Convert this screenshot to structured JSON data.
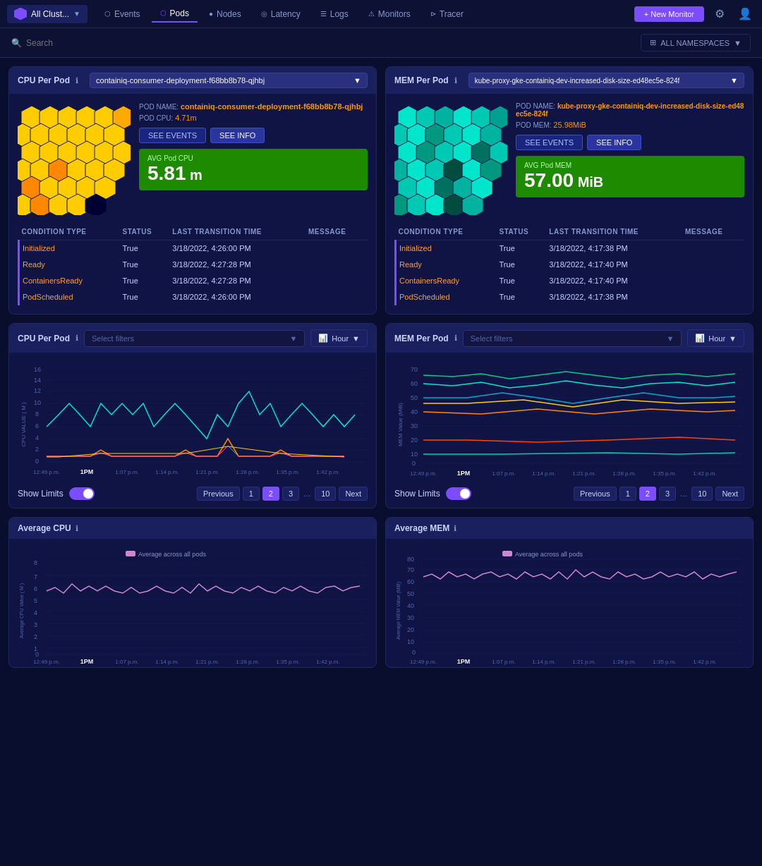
{
  "nav": {
    "brand": "All Clust...",
    "items": [
      {
        "label": "Events",
        "icon": "⬡",
        "active": false
      },
      {
        "label": "Pods",
        "icon": "⬡",
        "active": true
      },
      {
        "label": "Nodes",
        "icon": "⬡",
        "active": false
      },
      {
        "label": "Latency",
        "icon": "⬡",
        "active": false
      },
      {
        "label": "Logs",
        "icon": "⬡",
        "active": false
      },
      {
        "label": "Monitors",
        "icon": "⬡",
        "active": false
      },
      {
        "label": "Tracer",
        "icon": "⬡",
        "active": false
      }
    ],
    "new_monitor": "+ New Monitor",
    "all_namespaces": "ALL NAMESPACES"
  },
  "search": {
    "placeholder": "Search"
  },
  "cpu_pod_panel": {
    "title": "CPU Per Pod",
    "selected_pod": "containiq-consumer-deployment-f68bb8b78-qjhbj",
    "pod_name_label": "POD NAME:",
    "pod_name_val": "containiq-consumer-deployment-f68bb8b78-qjhbj",
    "pod_cpu_label": "POD CPU:",
    "pod_cpu_val": "4.71m",
    "btn_events": "SEE EVENTS",
    "btn_info": "SEE INFO",
    "avg_label": "AVG Pod CPU",
    "avg_value": "5.81",
    "avg_unit": " m"
  },
  "mem_pod_panel": {
    "title": "MEM Per Pod",
    "selected_pod": "kube-proxy-gke-containiq-dev-increased-disk-size-ed48ec5e-824f",
    "pod_name_label": "POD NAME:",
    "pod_name_val": "kube-proxy-gke-containiq-dev-increased-disk-size-ed48ec5e-824f",
    "pod_mem_label": "POD MEM:",
    "pod_mem_val": "25.98MiB",
    "btn_events": "SEE EVENTS",
    "btn_info": "SEE INFO",
    "avg_label": "AVG Pod MEM",
    "avg_value": "57.00",
    "avg_unit": " MiB"
  },
  "conditions_cpu": {
    "headers": [
      "CONDITION TYPE",
      "STATUS",
      "LAST TRANSITION TIME",
      "MESSAGE"
    ],
    "rows": [
      {
        "type": "Initialized",
        "status": "True",
        "time": "3/18/2022, 4:26:00 PM",
        "message": ""
      },
      {
        "type": "Ready",
        "status": "True",
        "time": "3/18/2022, 4:27:28 PM",
        "message": ""
      },
      {
        "type": "ContainersReady",
        "status": "True",
        "time": "3/18/2022, 4:27:28 PM",
        "message": ""
      },
      {
        "type": "PodScheduled",
        "status": "True",
        "time": "3/18/2022, 4:26:00 PM",
        "message": ""
      }
    ]
  },
  "conditions_mem": {
    "headers": [
      "CONDITION TYPE",
      "STATUS",
      "LAST TRANSITION TIME",
      "MESSAGE"
    ],
    "rows": [
      {
        "type": "Initialized",
        "status": "True",
        "time": "3/18/2022, 4:17:38 PM",
        "message": ""
      },
      {
        "type": "Ready",
        "status": "True",
        "time": "3/18/2022, 4:17:40 PM",
        "message": ""
      },
      {
        "type": "ContainersReady",
        "status": "True",
        "time": "3/18/2022, 4:17:40 PM",
        "message": ""
      },
      {
        "type": "PodScheduled",
        "status": "True",
        "time": "3/18/2022, 4:17:38 PM",
        "message": ""
      }
    ]
  },
  "cpu_chart": {
    "title": "CPU Per Pod",
    "filter_placeholder": "Select filters",
    "hour_label": "Hour",
    "y_axis_label": "CPU VALUE ( M )",
    "y_max": 16,
    "show_limits": "Show Limits",
    "x_labels": [
      "12:49 p.m.",
      "1PM",
      "1:07 p.m.",
      "1:14 p.m.",
      "1:21 p.m.",
      "1:28 p.m.",
      "1:35 p.m.",
      "1:42 p.m."
    ],
    "pagination": {
      "prev": "Previous",
      "pages": [
        "1",
        "2",
        "3",
        "...",
        "10"
      ],
      "next": "Next",
      "active": "1"
    }
  },
  "mem_chart": {
    "title": "MEM Per Pod",
    "filter_placeholder": "Select filters",
    "hour_label": "Hour",
    "y_axis_label": "MEM Value (MiB)",
    "y_max": 70,
    "show_limits": "Show Limits",
    "x_labels": [
      "12:49 p.m.",
      "1PM",
      "1:07 p.m.",
      "1:14 p.m.",
      "1:21 p.m.",
      "1:28 p.m.",
      "1:35 p.m.",
      "1:42 p.m."
    ],
    "pagination": {
      "prev": "Previous",
      "pages": [
        "1",
        "2",
        "3",
        "...",
        "10"
      ],
      "next": "Next",
      "active": "2"
    }
  },
  "avg_cpu": {
    "title": "Average CPU",
    "legend": "Average across all pods",
    "y_label": "Average CPU Value ( M )",
    "y_max": 8,
    "x_labels": [
      "12:49 p.m.",
      "1PM",
      "1:07 p.m.",
      "1:14 p.m.",
      "1:21 p.m.",
      "1:28 p.m.",
      "1:35 p.m.",
      "1:42 p.m."
    ]
  },
  "avg_mem": {
    "title": "Average MEM",
    "legend": "Average across all pods",
    "y_label": "Average MEM Value (MiB)",
    "y_max": 80,
    "x_labels": [
      "12:49 p.m.",
      "1PM",
      "1:07 p.m.",
      "1:14 p.m.",
      "1:21 p.m.",
      "1:28 p.m.",
      "1:35 p.m.",
      "1:42 p.m."
    ]
  }
}
